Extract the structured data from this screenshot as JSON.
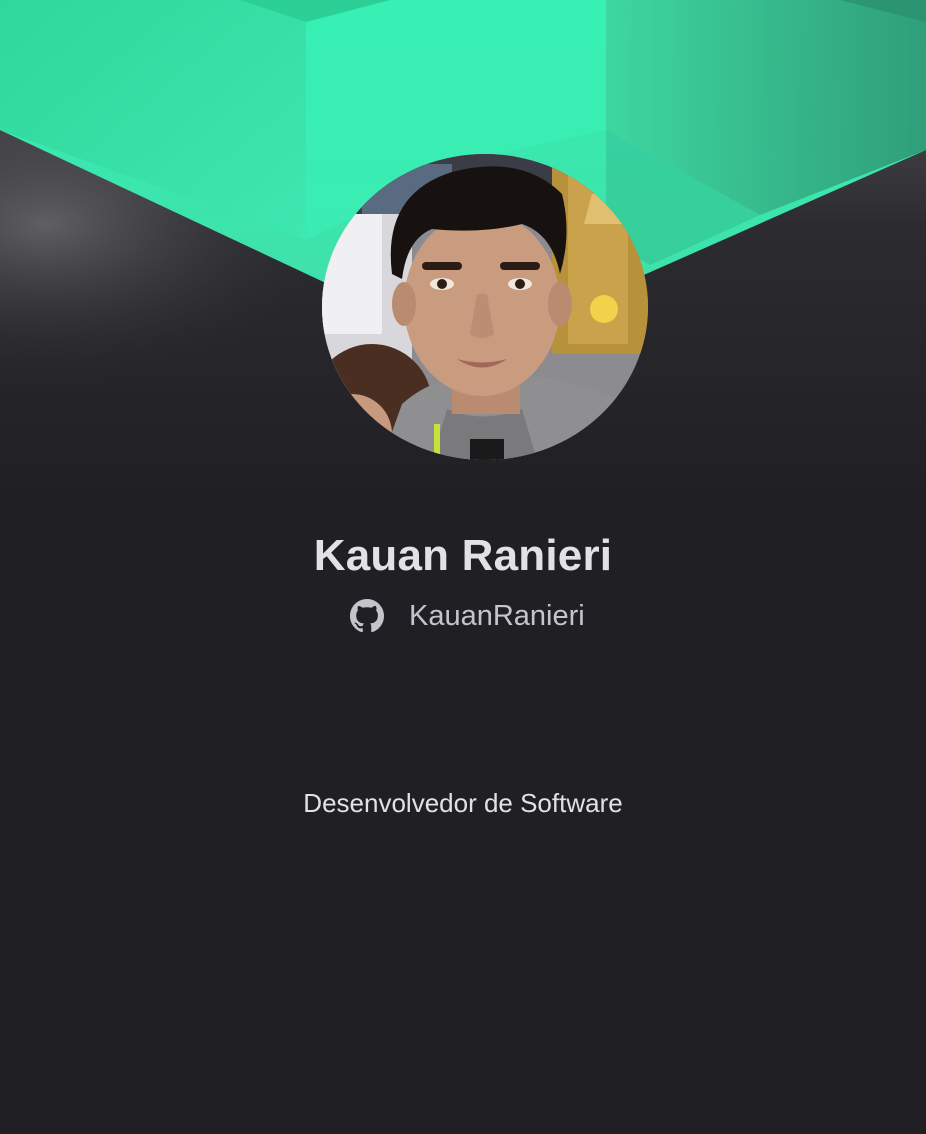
{
  "profile": {
    "name": "Kauan Ranieri",
    "github_username": "KauanRanieri",
    "bio": "Desenvolvedor de Software"
  },
  "icons": {
    "github": "github-icon",
    "avatar": "profile-photo"
  },
  "colors": {
    "background": "#202024",
    "accent": "#33e6a9",
    "text": "#e1e1e6",
    "muted_text": "#c4c4cc"
  }
}
